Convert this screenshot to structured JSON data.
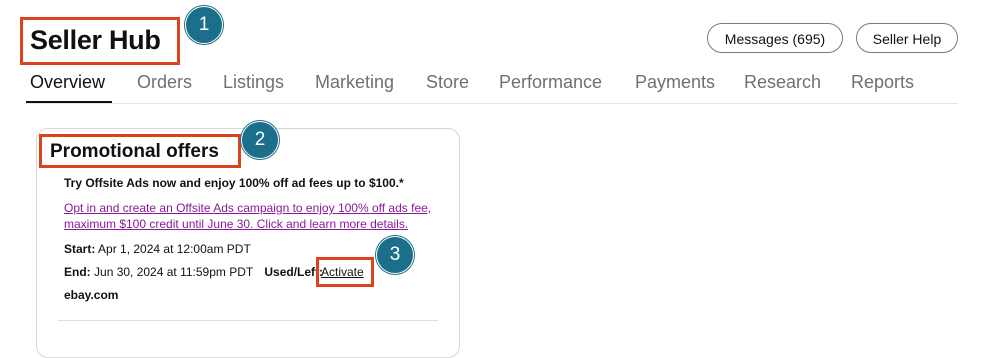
{
  "header": {
    "title": "Seller Hub",
    "messages_label": "Messages (695)",
    "help_label": "Seller Help"
  },
  "tabs": [
    {
      "label": "Overview",
      "active": true
    },
    {
      "label": "Orders"
    },
    {
      "label": "Listings"
    },
    {
      "label": "Marketing"
    },
    {
      "label": "Store"
    },
    {
      "label": "Performance"
    },
    {
      "label": "Payments"
    },
    {
      "label": "Research"
    },
    {
      "label": "Reports"
    }
  ],
  "card": {
    "title": "Promotional offers",
    "promo_headline": "Try Offsite Ads now and enjoy 100% off ad fees up to $100.*",
    "link_line1": "Opt in and create an Offsite Ads campaign to enjoy 100% off ads fee,",
    "link_line2": "maximum $100 credit until June 30. Click and learn more details.",
    "start_label": "Start:",
    "start_value": "Apr 1, 2024 at 12:00am PDT",
    "end_label": "End:",
    "end_value": "Jun 30, 2024 at 11:59pm PDT",
    "used_label": "Used/Left:",
    "activate_label": "Activate",
    "site": "ebay.com"
  },
  "markers": [
    "1",
    "2",
    "3"
  ],
  "colors": {
    "highlight": "#d9441c",
    "marker": "#1b6f8a",
    "link": "#8a1a9b"
  }
}
